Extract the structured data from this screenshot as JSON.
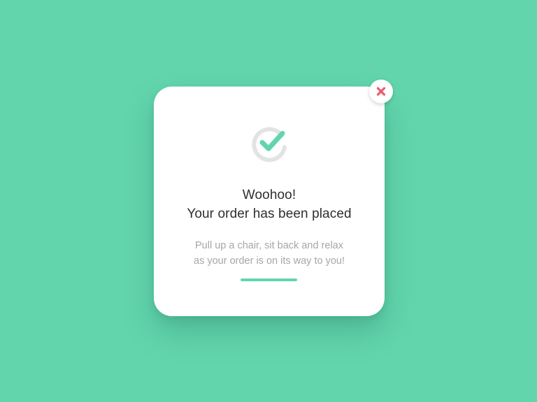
{
  "dialog": {
    "title_line1": "Woohoo!",
    "title_line2": "Your order has been placed",
    "message_line1": "Pull up a chair, sit back and relax",
    "message_line2": "as your order is on its way to you!"
  },
  "icons": {
    "status": "check-circle-icon",
    "close": "close-icon"
  },
  "colors": {
    "background": "#62d5ad",
    "accent": "#62d5ad",
    "close": "#ec5a6a",
    "check_ring": "#e3e3e3"
  }
}
